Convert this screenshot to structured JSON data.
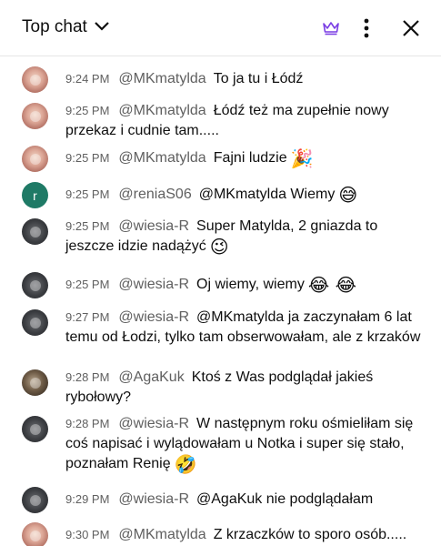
{
  "header": {
    "title": "Top chat",
    "chevron_icon": "chevron-down-icon",
    "crown_icon": "crown-icon",
    "more_icon": "more-vert-icon",
    "close_icon": "close-icon",
    "crown_color": "#7b3fe4"
  },
  "messages": [
    {
      "avatar": "mk",
      "time": "9:24 PM",
      "author": "@MKmatylda",
      "text": "To ja tu i Łódź",
      "emoji": ""
    },
    {
      "avatar": "mk",
      "time": "9:25 PM",
      "author": "@MKmatylda",
      "text": "Łódź też ma zupełnie nowy przekaz i cudnie tam.....",
      "emoji": ""
    },
    {
      "avatar": "mk",
      "time": "9:25 PM",
      "author": "@MKmatylda",
      "text": "Fajni ludzie",
      "emoji": "🎉"
    },
    {
      "avatar": "rn",
      "avatar_letter": "r",
      "time": "9:25 PM",
      "author": "@reniaS06",
      "text": "@MKmatylda Wiemy",
      "emoji": "😅"
    },
    {
      "avatar": "ws",
      "time": "9:25 PM",
      "author": "@wiesia-R",
      "text": "Super Matylda, 2 gniazda to jeszcze idzie nadążyć",
      "emoji": "😉"
    },
    {
      "avatar": "ws",
      "time": "9:25 PM",
      "author": "@wiesia-R",
      "text": "Oj wiemy, wiemy",
      "emoji": "😂 😂"
    },
    {
      "avatar": "ws",
      "time": "9:27 PM",
      "author": "@wiesia-R",
      "text": "@MKmatylda ja zaczynałam 6 lat temu od Łodzi, tylko tam obserwowałam, ale z krzaków",
      "emoji": ""
    },
    {
      "avatar": "ag",
      "time": "9:28 PM",
      "author": "@AgaKuk",
      "text": "Ktoś z Was podglądał jakieś rybołowy?",
      "emoji": ""
    },
    {
      "avatar": "ws",
      "time": "9:28 PM",
      "author": "@wiesia-R",
      "text": "W następnym roku ośmieliłam się coś napisać i wylądowałam u Notka i super się stało, poznałam Renię",
      "emoji": "🤣"
    },
    {
      "avatar": "ws",
      "time": "9:29 PM",
      "author": "@wiesia-R",
      "text": "@AgaKuk nie podglądałam",
      "emoji": ""
    },
    {
      "avatar": "mk",
      "time": "9:30 PM",
      "author": "@MKmatylda",
      "text": "Z krzaczków to sporo osób.....",
      "emoji": ""
    }
  ]
}
